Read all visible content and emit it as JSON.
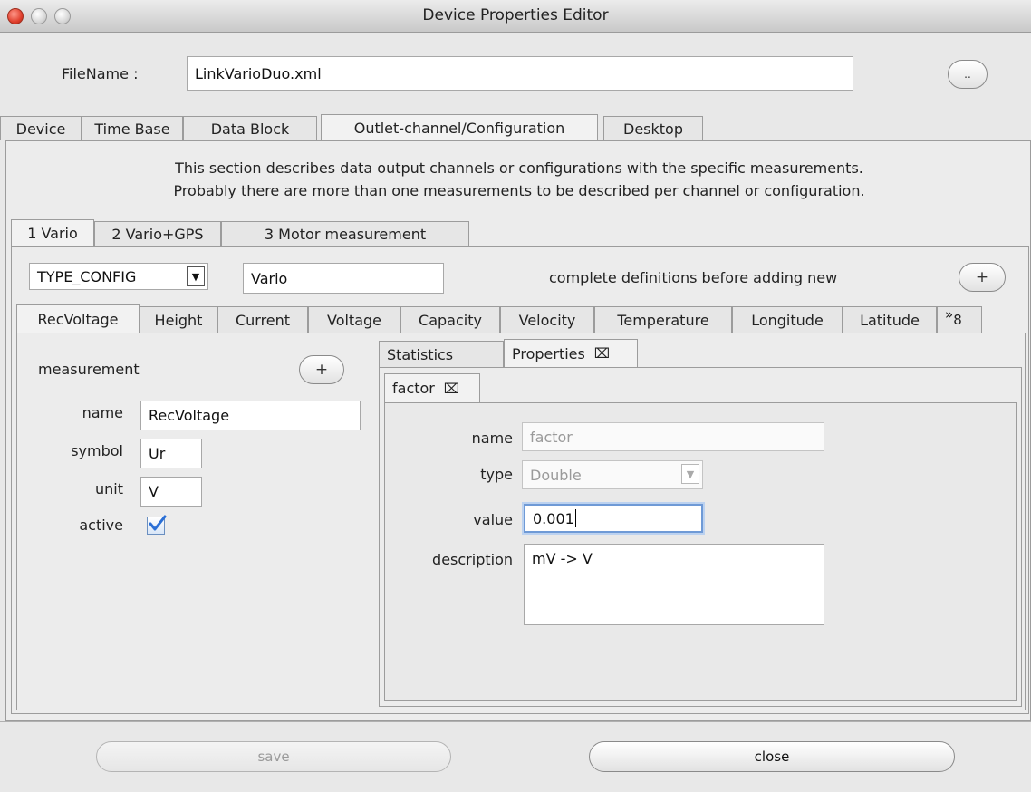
{
  "window": {
    "title": "Device Properties Editor"
  },
  "file": {
    "label": "FileName :",
    "value": "LinkVarioDuo.xml",
    "browse_label": ".."
  },
  "main_tabs": [
    "Device",
    "Time Base",
    "Data Block",
    "Outlet-channel/Configuration",
    "Desktop"
  ],
  "section": {
    "description_line1": "This section describes data output channels or configurations with the specific measurements.",
    "description_line2": "Probably there are more than one measurements to be described per channel or configuration."
  },
  "channel_tabs": [
    "1 Vario",
    "2 Vario+GPS",
    "3 Motor measurement"
  ],
  "config": {
    "type_select": "TYPE_CONFIG",
    "name_value": "Vario",
    "hint": "complete definitions before adding new",
    "add_label": "+"
  },
  "measurement_tabs": [
    "RecVoltage",
    "Height",
    "Current",
    "Voltage",
    "Capacity",
    "Velocity",
    "Temperature",
    "Longitude",
    "Latitude"
  ],
  "overflow_tabs": {
    "chevron": "»",
    "count": "8"
  },
  "measurement": {
    "heading": "measurement",
    "add_label": "+",
    "name_label": "name",
    "name_value": "RecVoltage",
    "symbol_label": "symbol",
    "symbol_value": "Ur",
    "unit_label": "unit",
    "unit_value": "V",
    "active_label": "active",
    "active_checked": true
  },
  "right_tabs": {
    "statistics": "Statistics",
    "properties": "Properties",
    "close_glyph": "⌧"
  },
  "property_tabs": {
    "factor": "factor"
  },
  "property": {
    "name_label": "name",
    "name_value": "factor",
    "type_label": "type",
    "type_value": "Double",
    "value_label": "value",
    "value_value": "0.001",
    "description_label": "description",
    "description_value": "mV -> V"
  },
  "footer": {
    "save_label": "save",
    "close_label": "close"
  },
  "colors": {
    "focus_ring": "#6f9ad6",
    "check_blue": "#2a6fd6",
    "close_light": "#e0402e"
  }
}
